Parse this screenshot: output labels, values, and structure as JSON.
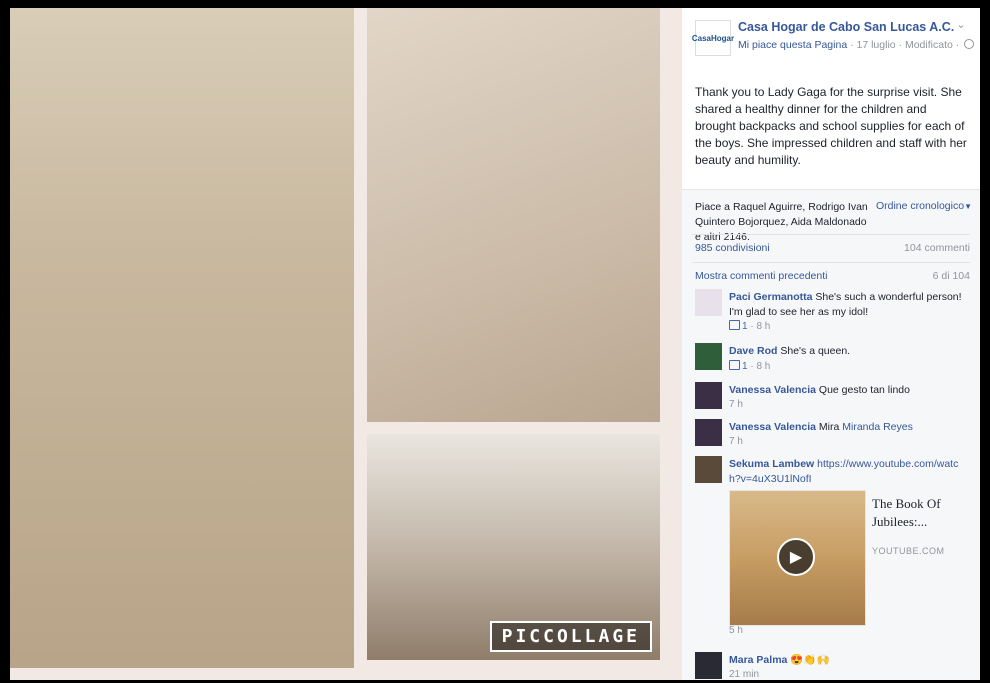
{
  "page": {
    "name": "Casa Hogar de Cabo San Lucas A.C.",
    "logo_text": "CasaHogar",
    "like_link": "Mi piace questa Pagina",
    "date": "17 luglio",
    "edited": "Modificato"
  },
  "post": {
    "text": "Thank you to Lady Gaga for the surprise visit. She shared a healthy dinner for the children and brought backpacks and school supplies for each of the boys. She impressed children and staff with her beauty and humility."
  },
  "collage": {
    "watermark": "PICCOLLAGE"
  },
  "stats": {
    "likes_text": "Piace a Raquel Aguirre, Rodrigo Ivan Quintero Bojorquez, Aida Maldonado e altri 2146.",
    "order_label": "Ordine cronologico",
    "shares": "985 condivisioni",
    "comments": "104 commenti",
    "prev_comments": "Mostra commenti precedenti",
    "pager": "6 di 104"
  },
  "comments": [
    {
      "author": "Paci Germanotta",
      "text": "She's such a wonderful person! I'm glad to see her as my idol!",
      "likes": "1",
      "time": "8 h"
    },
    {
      "author": "Dave Rod",
      "text": "She's a queen.",
      "likes": "1",
      "time": "8 h"
    },
    {
      "author": "Vanessa Valencia",
      "text": "Que gesto tan lindo",
      "time": "7 h"
    },
    {
      "author": "Vanessa Valencia",
      "text": "Mira",
      "mention": "Miranda Reyes",
      "time": "7 h"
    },
    {
      "author": "Sekuma Lambew",
      "link": "https://www.youtube.com/watch?v=4uX3U1lNofI",
      "time": "5 h",
      "preview": {
        "title": "The Book Of Jubilees:...",
        "domain": "YOUTUBE.COM"
      }
    },
    {
      "author": "Mara Palma",
      "text": "😍👏🙌",
      "time": "21 min"
    }
  ],
  "icons": {
    "chevron": "chevron-down-icon",
    "globe": "globe-icon",
    "thumb": "thumbs-up-icon",
    "play": "play-icon"
  },
  "colors": {
    "link": "#365899",
    "meta": "#90949c",
    "panel": "#f6f7f9"
  }
}
